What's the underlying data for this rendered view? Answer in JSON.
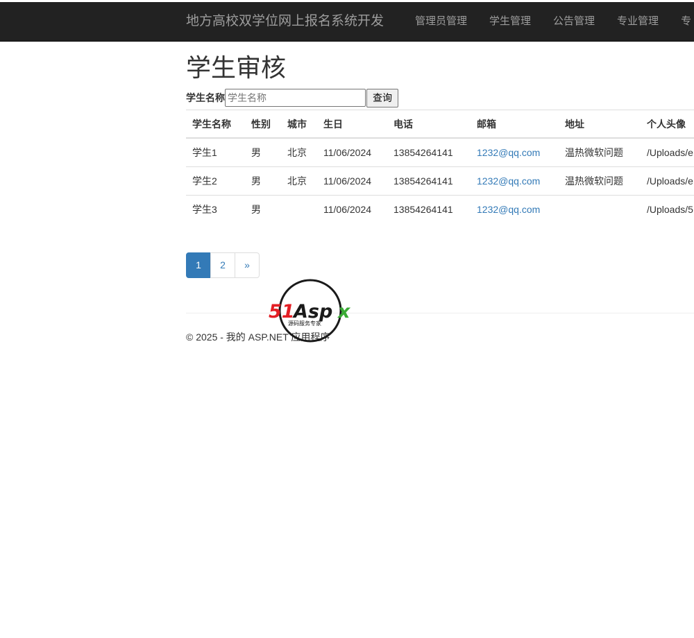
{
  "app": {
    "brand": "地方高校双学位网上报名系统开发"
  },
  "nav": {
    "items": [
      {
        "label": "管理员管理"
      },
      {
        "label": "学生管理"
      },
      {
        "label": "公告管理"
      },
      {
        "label": "专业管理"
      },
      {
        "label": "专"
      }
    ]
  },
  "page": {
    "title": "学生审核"
  },
  "search": {
    "label": "学生名称",
    "placeholder": "学生名称",
    "value": "",
    "button_label": "查询"
  },
  "table": {
    "headers": [
      "学生名称",
      "性别",
      "城市",
      "生日",
      "电话",
      "邮箱",
      "地址",
      "个人头像"
    ],
    "rows": [
      {
        "name": "学生1",
        "gender": "男",
        "city": "北京",
        "birthday": "11/06/2024",
        "phone": "13854264141",
        "email": "1232@qq.com",
        "address": "温热微软问题",
        "avatar": "/Uploads/e"
      },
      {
        "name": "学生2",
        "gender": "男",
        "city": "北京",
        "birthday": "11/06/2024",
        "phone": "13854264141",
        "email": "1232@qq.com",
        "address": "温热微软问题",
        "avatar": "/Uploads/e"
      },
      {
        "name": "学生3",
        "gender": "男",
        "city": "",
        "birthday": "11/06/2024",
        "phone": "13854264141",
        "email": "1232@qq.com",
        "address": "",
        "avatar": "/Uploads/5"
      }
    ]
  },
  "pagination": {
    "pages": [
      "1",
      "2"
    ],
    "next": "»",
    "current": "1",
    "active_color": "#337ab7"
  },
  "footer": {
    "text": "© 2025 - 我的 ASP.NET 应用程序"
  },
  "watermark": {
    "text": "51Aspx",
    "subtext": "源码服务专家"
  },
  "colors": {
    "navbar": "#222222",
    "nav_text": "#9d9d9d",
    "link": "#337ab7"
  }
}
